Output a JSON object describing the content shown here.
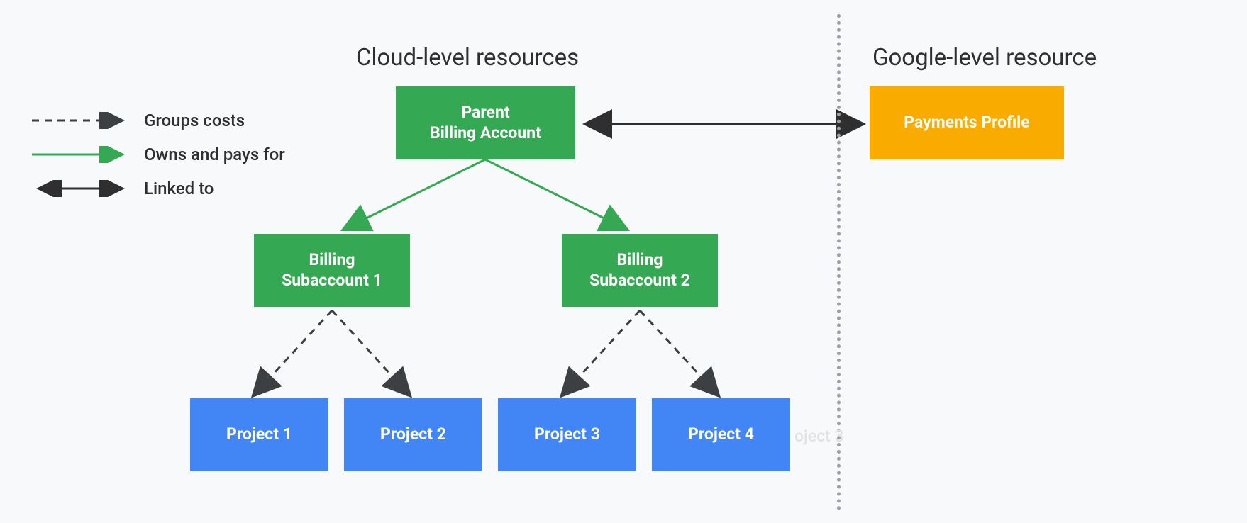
{
  "titles": {
    "cloud": "Cloud-level resources",
    "google": "Google-level resource"
  },
  "legend": {
    "groups": "Groups costs",
    "owns": "Owns and pays for",
    "linked": "Linked to"
  },
  "boxes": {
    "parent_line1": "Parent",
    "parent_line2": "Billing Account",
    "sub1_line1": "Billing",
    "sub1_line2": "Subaccount 1",
    "sub2_line1": "Billing",
    "sub2_line2": "Subaccount 2",
    "project1": "Project 1",
    "project2": "Project 2",
    "project3": "Project 3",
    "project4": "Project 4",
    "payments": "Payments Profile"
  },
  "ghost": {
    "text": "oject 3"
  },
  "colors": {
    "green": "#34a853",
    "blue": "#4285f4",
    "amber": "#f9ab00",
    "text": "#2f2f2f",
    "ghost": "#e0e2e4",
    "dashed": "#3c4043"
  }
}
